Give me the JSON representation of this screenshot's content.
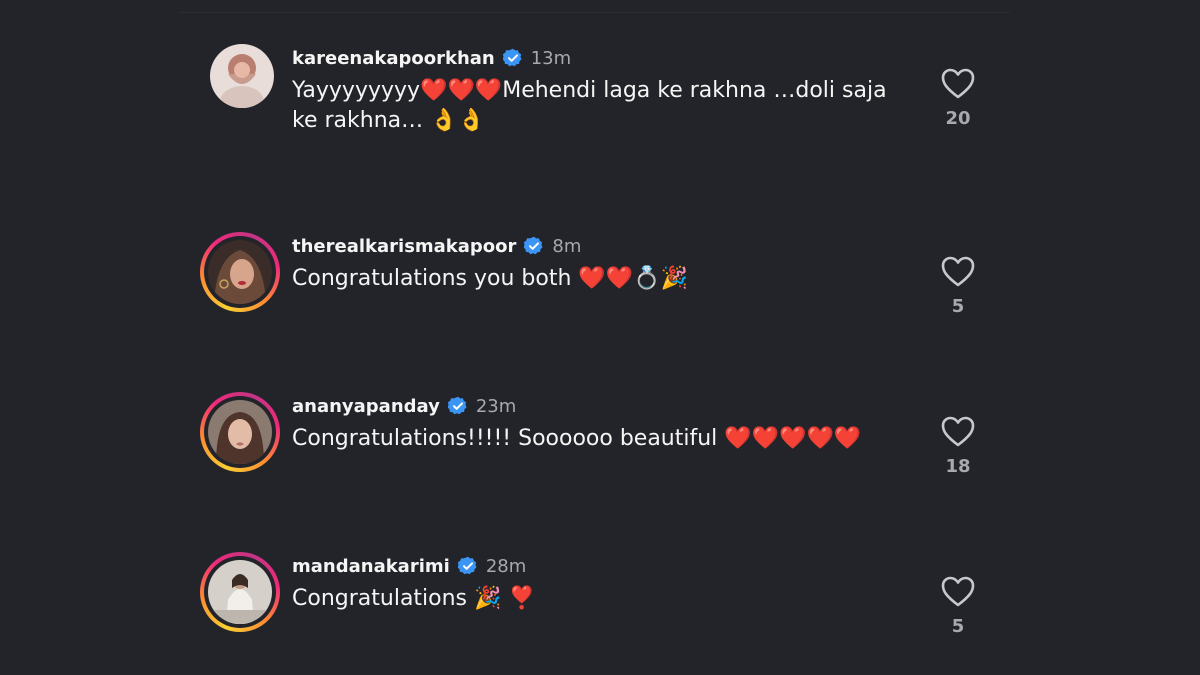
{
  "comments": [
    {
      "username": "kareenakapoorkhan",
      "time": "13m",
      "text": "Yayyyyyyyy❤️❤️❤️Mehendi laga ke rakhna …doli saja ke rakhna… 👌👌",
      "likes": "20",
      "story_ring": false,
      "avatar_colors": [
        "#d9c9c4",
        "#a86a5e"
      ]
    },
    {
      "username": "therealkarismakapoor",
      "time": "8m",
      "text": "Congratulations you both ❤️❤️💍🎉",
      "likes": "5",
      "story_ring": true,
      "avatar_colors": [
        "#5a4038",
        "#8c5f4a"
      ]
    },
    {
      "username": "ananyapanday",
      "time": "23m",
      "text": "Congratulations!!!!! Soooooo beautiful ❤️❤️❤️❤️❤️",
      "likes": "18",
      "story_ring": true,
      "avatar_colors": [
        "#b59a8c",
        "#4a3128"
      ]
    },
    {
      "username": "mandanakarimi",
      "time": "28m",
      "text": "Congratulations 🎉 ❣️",
      "likes": "5",
      "story_ring": true,
      "avatar_colors": [
        "#c9c3bc",
        "#6e6660"
      ]
    }
  ],
  "icons": {
    "verified": "verified-badge-icon",
    "like": "heart-outline-icon"
  },
  "colors": {
    "background": "#232429",
    "verified": "#3b95f5",
    "muted_text": "#a8a8ad"
  }
}
